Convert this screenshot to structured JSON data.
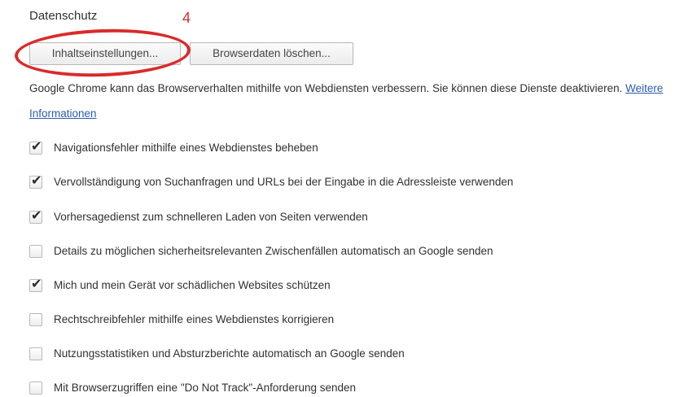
{
  "section": {
    "title": "Datenschutz"
  },
  "annotation": {
    "number": "4",
    "color": "#d92b2b"
  },
  "buttons": {
    "content_settings": "Inhaltseinstellungen...",
    "clear_browsing_data": "Browserdaten löschen..."
  },
  "description": {
    "text": "Google Chrome kann das Browserverhalten mithilfe von Webdiensten verbessern. Sie können diese Dienste deaktivieren.",
    "link": "Weitere Informationen"
  },
  "options": [
    {
      "label": "Navigationsfehler mithilfe eines Webdienstes beheben",
      "checked": true
    },
    {
      "label": "Vervollständigung von Suchanfragen und URLs bei der Eingabe in die Adressleiste verwenden",
      "checked": true
    },
    {
      "label": "Vorhersagedienst zum schnelleren Laden von Seiten verwenden",
      "checked": true
    },
    {
      "label": "Details zu möglichen sicherheitsrelevanten Zwischenfällen automatisch an Google senden",
      "checked": false
    },
    {
      "label": "Mich und mein Gerät vor schädlichen Websites schützen",
      "checked": true
    },
    {
      "label": "Rechtschreibfehler mithilfe eines Webdienstes korrigieren",
      "checked": false
    },
    {
      "label": "Nutzungsstatistiken und Absturzberichte automatisch an Google senden",
      "checked": false
    },
    {
      "label": "Mit Browserzugriffen eine \"Do Not Track\"-Anforderung senden",
      "checked": false
    }
  ]
}
